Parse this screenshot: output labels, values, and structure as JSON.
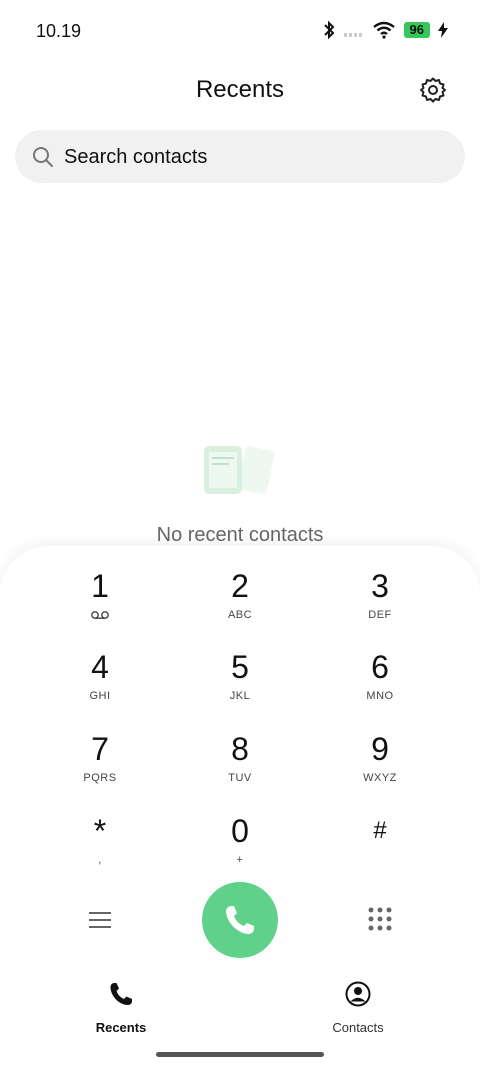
{
  "status_bar": {
    "time": "10.19",
    "battery": "96"
  },
  "header": {
    "title": "Recents"
  },
  "search": {
    "placeholder": "Search contacts"
  },
  "empty_state": {
    "text": "No recent contacts"
  },
  "dialpad": {
    "keys": [
      {
        "digit": "1",
        "letters": ""
      },
      {
        "digit": "2",
        "letters": "ABC"
      },
      {
        "digit": "3",
        "letters": "DEF"
      },
      {
        "digit": "4",
        "letters": "GHI"
      },
      {
        "digit": "5",
        "letters": "JKL"
      },
      {
        "digit": "6",
        "letters": "MNO"
      },
      {
        "digit": "7",
        "letters": "PQRS"
      },
      {
        "digit": "8",
        "letters": "TUV"
      },
      {
        "digit": "9",
        "letters": "WXYZ"
      },
      {
        "digit": "*",
        "letters": ","
      },
      {
        "digit": "0",
        "letters": "+"
      },
      {
        "digit": "#",
        "letters": ""
      }
    ]
  },
  "bottom_nav": {
    "recents_label": "Recents",
    "contacts_label": "Contacts"
  },
  "colors": {
    "accent_green": "#5fd18a",
    "battery_green": "#34c759"
  }
}
